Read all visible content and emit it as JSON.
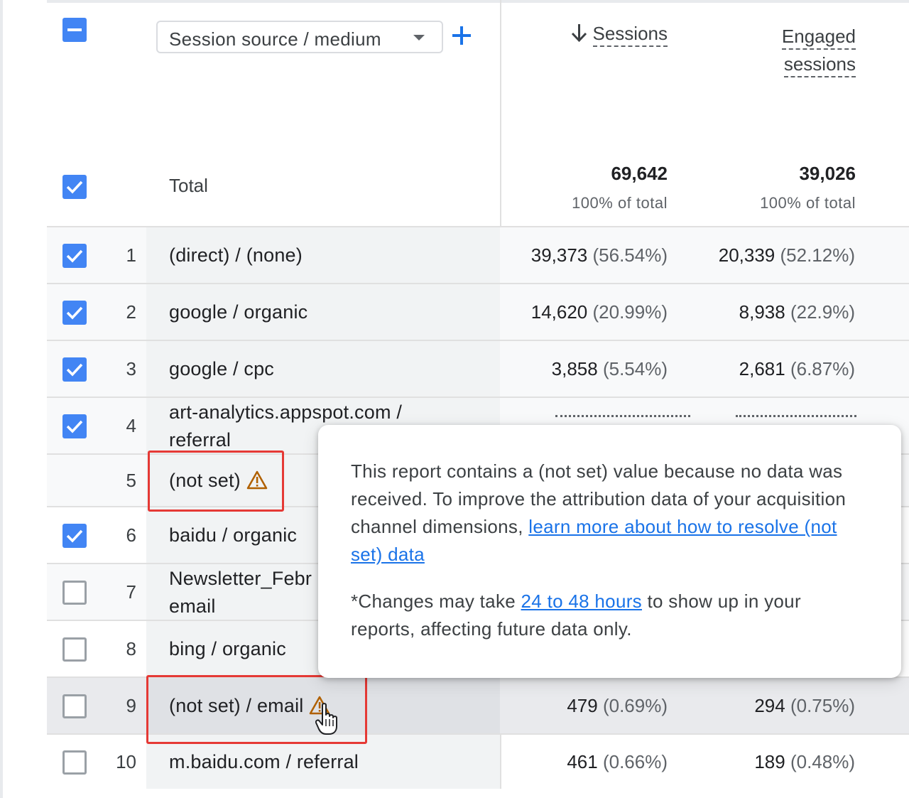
{
  "header": {
    "dimension_select": "Session source / medium",
    "sessions_label": "Sessions",
    "engaged_label_1": "Engaged",
    "engaged_label_2": "sessions"
  },
  "totals": {
    "label": "Total",
    "sessions": "69,642",
    "sessions_sub": "100% of total",
    "engaged": "39,026",
    "engaged_sub": "100% of total"
  },
  "rows": [
    {
      "num": "1",
      "dim": "(direct) / (none)",
      "dim2": "",
      "sessions": "39,373",
      "sessions_pct": "(56.54%)",
      "engaged": "20,339",
      "engaged_pct": "(52.12%)",
      "checked": true
    },
    {
      "num": "2",
      "dim": "google / organic",
      "dim2": "",
      "sessions": "14,620",
      "sessions_pct": "(20.99%)",
      "engaged": "8,938",
      "engaged_pct": "(22.9%)",
      "checked": true
    },
    {
      "num": "3",
      "dim": "google / cpc",
      "dim2": "",
      "sessions": "3,858",
      "sessions_pct": "(5.54%)",
      "engaged": "2,681",
      "engaged_pct": "(6.87%)",
      "checked": true
    },
    {
      "num": "4",
      "dim": "art-analytics.appspot.com /",
      "dim2": "referral",
      "sessions": "",
      "sessions_pct": "",
      "engaged": "",
      "engaged_pct": "",
      "checked": true
    },
    {
      "num": "5",
      "dim": "(not set)",
      "dim2": "",
      "sessions": "",
      "sessions_pct": "",
      "engaged": "",
      "engaged_pct": "",
      "checked": null
    },
    {
      "num": "6",
      "dim": "baidu / organic",
      "dim2": "",
      "sessions": "",
      "sessions_pct": "",
      "engaged": "",
      "engaged_pct": "",
      "checked": true
    },
    {
      "num": "7",
      "dim": "Newsletter_Febr",
      "dim2": "email",
      "sessions": "",
      "sessions_pct": "",
      "engaged": "",
      "engaged_pct": "",
      "checked": false
    },
    {
      "num": "8",
      "dim": "bing / organic",
      "dim2": "",
      "sessions": "",
      "sessions_pct": "",
      "engaged": "",
      "engaged_pct": "",
      "checked": false
    },
    {
      "num": "9",
      "dim": "(not set) / email",
      "dim2": "",
      "sessions": "479",
      "sessions_pct": "(0.69%)",
      "engaged": "294",
      "engaged_pct": "(0.75%)",
      "checked": false
    },
    {
      "num": "10",
      "dim": "m.baidu.com / referral",
      "dim2": "",
      "sessions": "461",
      "sessions_pct": "(0.66%)",
      "engaged": "189",
      "engaged_pct": "(0.48%)",
      "checked": false
    }
  ],
  "tooltip": {
    "p1_text": "This report contains a (not set) value because no data was received. To improve the attribution data of your acquisition channel dimensions, ",
    "p1_link": "learn more about how to resolve (not set) data",
    "p2_pre": "*Changes may take ",
    "p2_link": "24 to 48 hours",
    "p2_post": " to show up in your reports, affecting future data only."
  },
  "colors": {
    "checkbox_blue": "#4285f4",
    "link_blue": "#1a73e8",
    "highlight_red": "#e53935",
    "warning_amber": "#b06000"
  }
}
